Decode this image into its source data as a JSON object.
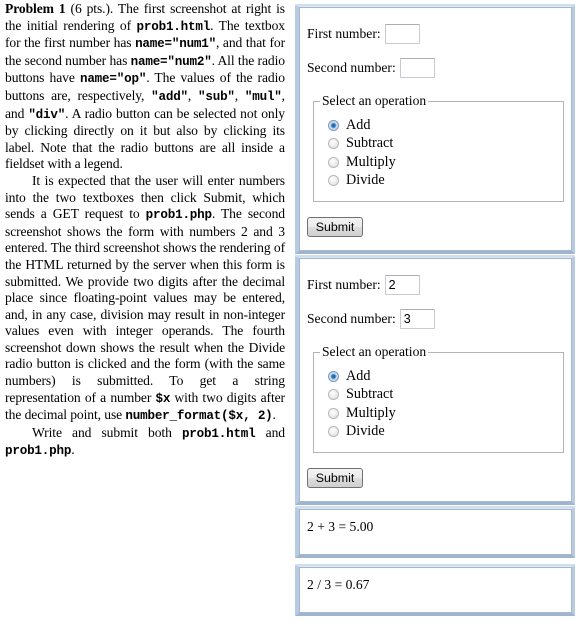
{
  "problem": {
    "heading": "Problem 1",
    "points": "(6 pts.).",
    "p1": [
      {
        "t": "text",
        "v": " The first screenshot at right is the initial rendering of "
      },
      {
        "t": "code",
        "v": "prob1.html"
      },
      {
        "t": "text",
        "v": ". The textbox for the first number has "
      },
      {
        "t": "code",
        "v": "name=\"num1\""
      },
      {
        "t": "text",
        "v": ", and that for the second number has "
      },
      {
        "t": "code",
        "v": "name=\"num2\""
      },
      {
        "t": "text",
        "v": ". All the radio buttons have "
      },
      {
        "t": "code",
        "v": "name=\"op\""
      },
      {
        "t": "text",
        "v": ". The values of the radio buttons are, respectively, "
      },
      {
        "t": "code",
        "v": "\"add\""
      },
      {
        "t": "text",
        "v": ", "
      },
      {
        "t": "code",
        "v": "\"sub\""
      },
      {
        "t": "text",
        "v": ", "
      },
      {
        "t": "code",
        "v": "\"mul\""
      },
      {
        "t": "text",
        "v": ", and "
      },
      {
        "t": "code",
        "v": "\"div\""
      },
      {
        "t": "text",
        "v": ". A radio button can be selected not only by clicking directly on it but also by clicking its label. Note that the radio buttons are all inside a fieldset with a legend."
      }
    ],
    "p2": [
      {
        "t": "text",
        "v": "It is expected that the user will enter numbers into the two textboxes then click Submit, which sends a GET request to "
      },
      {
        "t": "code",
        "v": "prob1.php"
      },
      {
        "t": "text",
        "v": ". The second screenshot shows the form with numbers 2 and 3 entered. The third screenshot shows the rendering of the HTML returned by the server when this form is submitted. We provide two digits after the decimal place since floating-point values may be entered, and, in any case, division may result in non-integer values even with integer operands. The fourth screenshot down shows the result when the Divide radio button is clicked and the form (with the same numbers) is submitted. To get a string representation of a number "
      },
      {
        "t": "code",
        "v": "$x"
      },
      {
        "t": "text",
        "v": " with two digits after the decimal point, use "
      },
      {
        "t": "code",
        "v": "number_format($x, 2)"
      },
      {
        "t": "text",
        "v": "."
      }
    ],
    "p3": [
      {
        "t": "text",
        "v": "Write and submit both "
      },
      {
        "t": "code",
        "v": "prob1.html"
      },
      {
        "t": "text",
        "v": " and "
      },
      {
        "t": "code",
        "v": "prob1.php"
      },
      {
        "t": "text",
        "v": "."
      }
    ]
  },
  "screenshots": {
    "initial_form": {
      "first_label": "First number:",
      "first_value": "",
      "second_label": "Second number:",
      "second_value": "",
      "legend": "Select an operation",
      "options": [
        {
          "label": "Add",
          "value": "add",
          "checked": true
        },
        {
          "label": "Subtract",
          "value": "sub",
          "checked": false
        },
        {
          "label": "Multiply",
          "value": "mul",
          "checked": false
        },
        {
          "label": "Divide",
          "value": "div",
          "checked": false
        }
      ],
      "submit_label": "Submit"
    },
    "filled_form": {
      "first_label": "First number:",
      "first_value": "2",
      "second_label": "Second number:",
      "second_value": "3",
      "legend": "Select an operation",
      "options": [
        {
          "label": "Add",
          "value": "add",
          "checked": true
        },
        {
          "label": "Subtract",
          "value": "sub",
          "checked": false
        },
        {
          "label": "Multiply",
          "value": "mul",
          "checked": false
        },
        {
          "label": "Divide",
          "value": "div",
          "checked": false
        }
      ],
      "submit_label": "Submit"
    },
    "add_result": {
      "text": "2 + 3 = 5.00"
    },
    "divide_result": {
      "text": "2 / 3 = 0.67"
    }
  }
}
